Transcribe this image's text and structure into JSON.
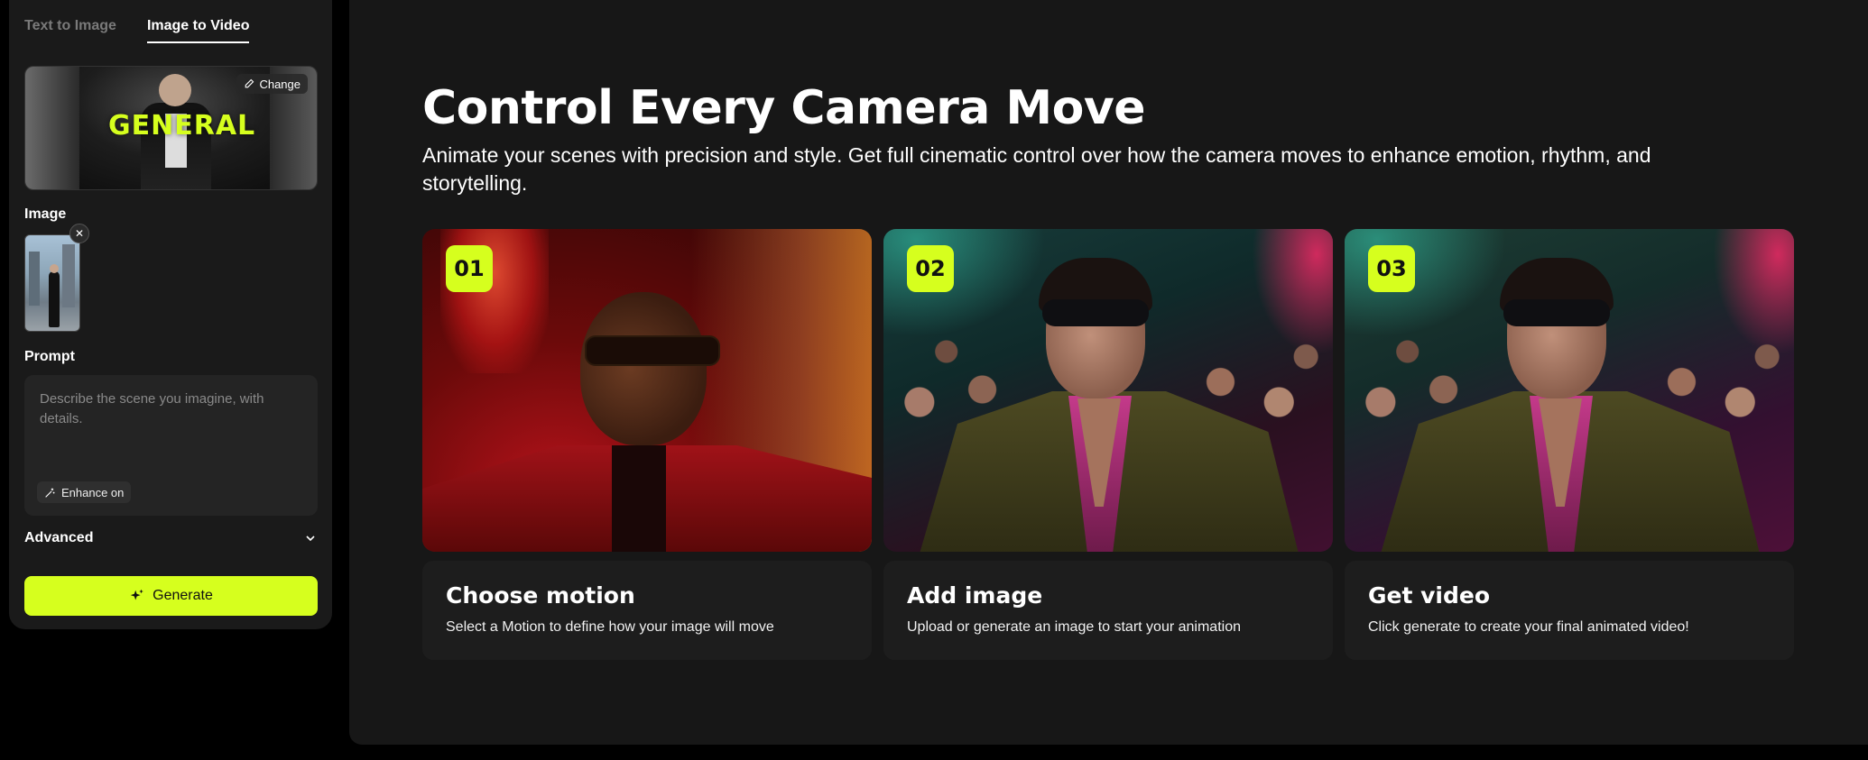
{
  "tabs": {
    "text_to_image": "Text to Image",
    "image_to_video": "Image to Video"
  },
  "motion": {
    "title": "GENERAL",
    "change_label": "Change"
  },
  "image_section": {
    "label": "Image"
  },
  "prompt": {
    "label": "Prompt",
    "placeholder": "Describe the scene you imagine, with details.",
    "enhance_label": "Enhance on"
  },
  "advanced": {
    "label": "Advanced"
  },
  "generate": {
    "label": "Generate"
  },
  "hero": {
    "title": "Control Every Camera Move",
    "subtitle": "Animate your scenes with precision and style. Get full cinematic control over how the camera moves to enhance emotion, rhythm, and storytelling."
  },
  "steps": [
    {
      "number": "01",
      "title": "Choose motion",
      "description": "Select a Motion to define how your image will move"
    },
    {
      "number": "02",
      "title": "Add image",
      "description": "Upload or generate an image to start your animation"
    },
    {
      "number": "03",
      "title": "Get video",
      "description": "Click generate to create your final animated video!"
    }
  ],
  "colors": {
    "accent": "#d6ff1e",
    "panel": "#1a1a1a",
    "main_bg": "#171717"
  }
}
